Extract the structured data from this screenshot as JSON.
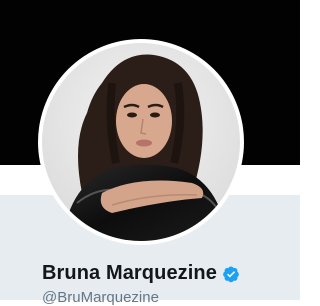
{
  "profile": {
    "display_name": "Bruna Marquezine",
    "handle": "@BruMarquezine",
    "verified": true,
    "verified_icon": "verified-badge-icon",
    "avatar_icon": "profile-photo"
  },
  "colors": {
    "banner": "#020202",
    "info_background": "#e6ecf0",
    "verified_badge": "#1da1f2",
    "name": "#14171a",
    "handle": "#657786"
  }
}
